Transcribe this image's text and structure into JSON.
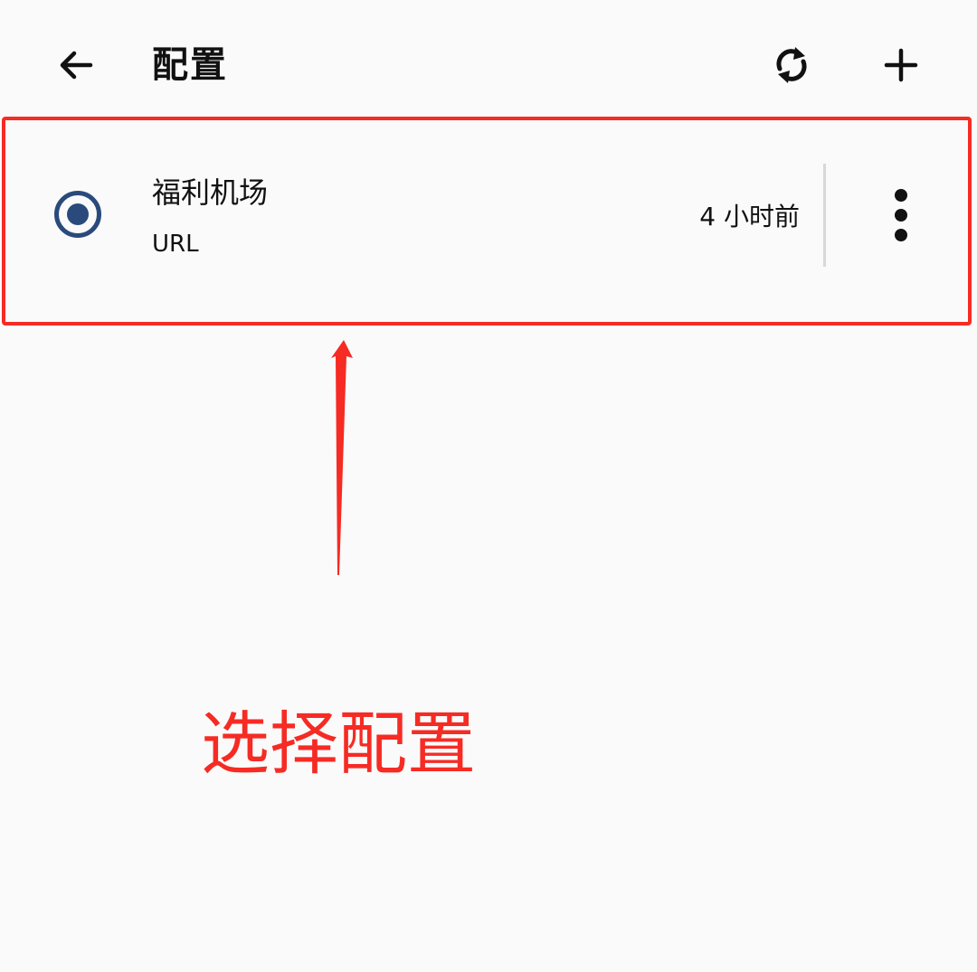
{
  "header": {
    "title": "配置",
    "back_icon": "arrow-left-icon",
    "refresh_icon": "sync-icon",
    "add_icon": "plus-icon"
  },
  "profiles": [
    {
      "name": "福利机场",
      "type": "URL",
      "updated": "4 小时前",
      "selected": true,
      "menu_icon": "more-vertical-icon"
    }
  ],
  "annotation": {
    "text": "选择配置",
    "color": "#f62b24"
  },
  "colors": {
    "background": "#fafafa",
    "accent": "#2a4a7c",
    "annotation": "#f62b24",
    "divider": "#d8d8d8"
  }
}
